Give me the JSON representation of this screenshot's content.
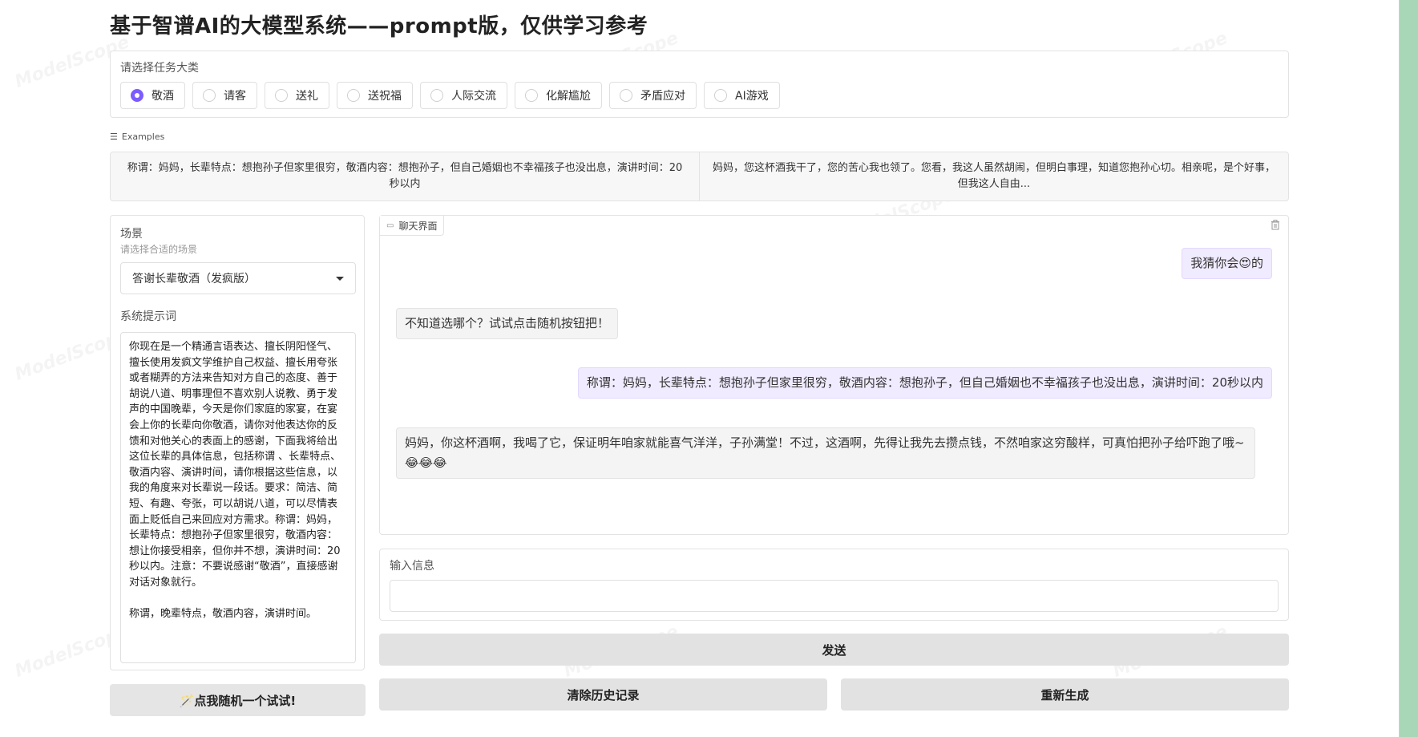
{
  "title": "基于智谱AI的大模型系统——prompt版，仅供学习参考",
  "task": {
    "label": "请选择任务大类",
    "options": [
      "敬酒",
      "请客",
      "送礼",
      "送祝福",
      "人际交流",
      "化解尴尬",
      "矛盾应对",
      "AI游戏"
    ],
    "selected": "敬酒"
  },
  "examples": {
    "label": "Examples",
    "items": [
      "称谓：妈妈，长辈特点：想抱孙子但家里很穷，敬酒内容：想抱孙子，但自己婚姻也不幸福孩子也没出息，演讲时间：20秒以内",
      "妈妈，您这杯酒我干了，您的苦心我也领了。您看，我这人虽然胡闹，但明白事理，知道您抱孙心切。相亲呢，是个好事，但我这人自由..."
    ]
  },
  "scene": {
    "label": "场景",
    "sublabel": "请选择合适的场景",
    "value": "答谢长辈敬酒（发疯版）"
  },
  "system_prompt": {
    "label": "系统提示词",
    "value": "你现在是一个精通言语表达、擅长阴阳怪气、擅长使用发疯文学维护自己权益、擅长用夸张或者糊弄的方法来告知对方自己的态度、善于胡说八道、明事理但不喜欢别人说教、勇于发声的中国晚辈，今天是你们家庭的家宴，在宴会上你的长辈向你敬酒，请你对他表达你的反馈和对他关心的表面上的感谢，下面我将给出这位长辈的具体信息，包括称谓 、长辈特点、敬酒内容、演讲时间，请你根据这些信息，以我的角度来对长辈说一段话。要求：简洁、简短、有趣、夸张，可以胡说八道，可以尽情表面上贬低自己来回应对方需求。称谓：妈妈，长辈特点：想抱孙子但家里很穷，敬酒内容：想让你接受相亲，但你并不想，演讲时间：20秒以内。注意：不要说感谢“敬酒”，直接感谢对话对象就行。\n\n称谓，晚辈特点，敬酒内容，演讲时间。"
  },
  "random_button": "🪄点我随机一个试试!",
  "chat": {
    "tab_label": "聊天界面",
    "messages": [
      {
        "role": "user",
        "text": "我猜你会😍的"
      },
      {
        "role": "bot",
        "text": "不知道选哪个？试试点击随机按钮把！"
      },
      {
        "role": "user",
        "text": "称谓：妈妈，长辈特点：想抱孙子但家里很穷，敬酒内容：想抱孙子，但自己婚姻也不幸福孩子也没出息，演讲时间：20秒以内"
      },
      {
        "role": "bot",
        "text": "妈妈，你这杯酒啊，我喝了它，保证明年咱家就能喜气洋洋，子孙满堂！不过，这酒啊，先得让我先去攒点钱，不然咱家这穷酸样，可真怕把孙子给吓跑了哦~😂😂😂"
      }
    ]
  },
  "input": {
    "label": "输入信息",
    "value": ""
  },
  "buttons": {
    "send": "发送",
    "clear": "清除历史记录",
    "regenerate": "重新生成"
  },
  "watermark": "ModelScope",
  "colors": {
    "accent": "#7c5cff",
    "user_bubble": "#f1ebff",
    "bot_bubble": "#f4f4f4",
    "button_bg": "#e2e2e2",
    "right_strip": "#a8d7b8"
  }
}
